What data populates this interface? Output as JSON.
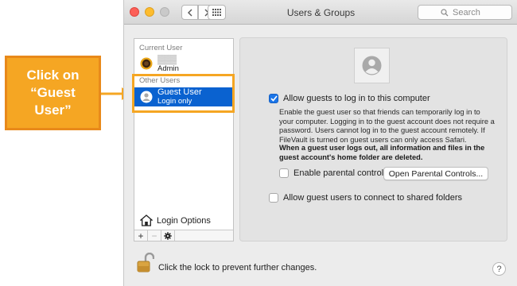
{
  "annotation": {
    "callout_text": "Click on\n“Guest\nUser”"
  },
  "window": {
    "title": "Users & Groups",
    "search_placeholder": "Search",
    "nav_back_glyph": "‹",
    "nav_forward_glyph": "›"
  },
  "sidebar": {
    "current_user_label": "Current User",
    "current_user_role": "Admin",
    "other_users_label": "Other Users",
    "guest_user": {
      "name": "Guest User",
      "status": "Login only"
    },
    "login_options_label": "Login Options",
    "add_glyph": "+",
    "remove_glyph": "−",
    "gear_glyph": "✱"
  },
  "panel": {
    "allow_guests": {
      "label": "Allow guests to log in to this computer",
      "checked": true
    },
    "description": "Enable the guest user so that friends can temporarily log in to your computer. Logging in to the guest account does not require a password. Users cannot log in to the guest account remotely. If FileVault is turned on guest users can only access Safari.",
    "description_bold": "When a guest user logs out, all information and files in the guest account's home folder are deleted.",
    "parental_controls": {
      "label": "Enable parental controls",
      "checked": false
    },
    "open_parental_button": "Open Parental Controls...",
    "shared_folders": {
      "label": "Allow guest users to connect to shared folders",
      "checked": false
    }
  },
  "footer": {
    "lock_text": "Click the lock to prevent further changes.",
    "help_glyph": "?"
  },
  "colors": {
    "callout_fill": "#f5a623",
    "callout_border": "#e8891a",
    "selection_blue": "#0a62d0",
    "checkbox_blue": "#1b75e8",
    "close": "#fc5f57",
    "minimize": "#fdbc2e"
  },
  "icons": {
    "back": "chevron-left-icon",
    "forward": "chevron-right-icon",
    "grid": "grid-icon",
    "search": "magnifier-icon",
    "admin_avatar": "sunflower-avatar-icon",
    "guest_avatar": "person-icon",
    "home": "home-icon",
    "gear": "gear-icon",
    "lock": "unlocked-padlock-icon",
    "help": "question-mark-icon"
  }
}
